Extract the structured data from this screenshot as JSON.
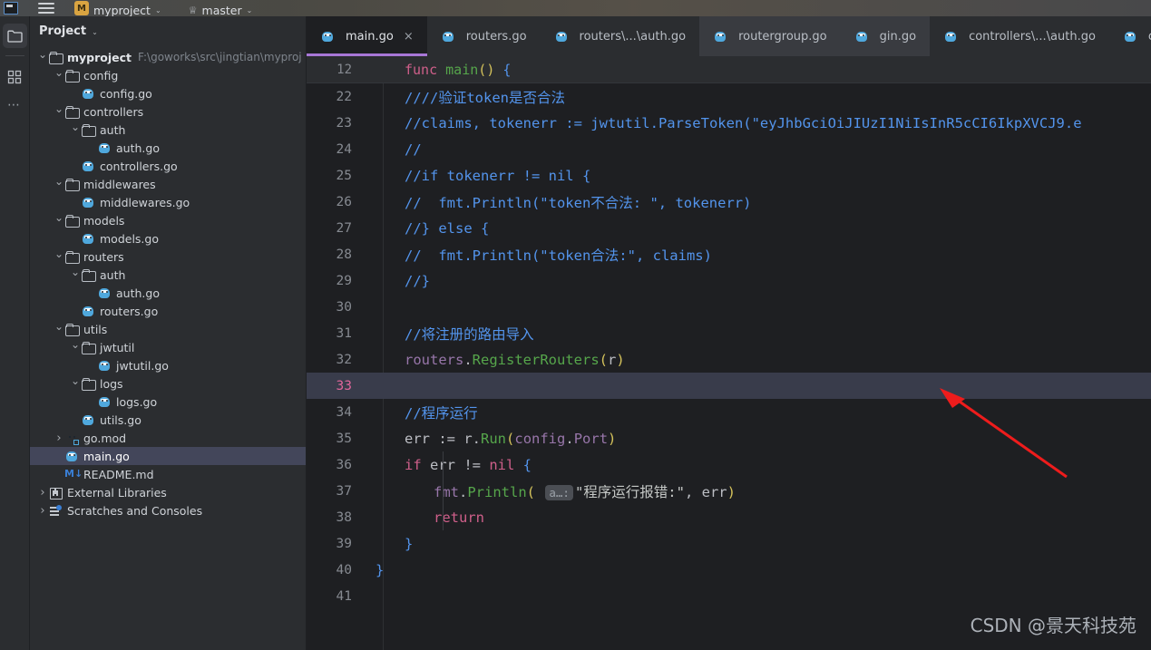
{
  "window": {
    "win_icon": "terminal-icon",
    "menu_icon": "hamburger-menu-icon",
    "project_badge": "M",
    "project_name": "myproject",
    "branch_icon": "branch-icon",
    "branch_name": "master",
    "caret": "⌄"
  },
  "rail": {
    "items": [
      {
        "name": "project-tool-icon",
        "label": "Project",
        "active": true
      },
      {
        "name": "structure-tool-icon",
        "label": "Structure",
        "active": false
      },
      {
        "name": "more-tool-icon",
        "label": "More",
        "active": false
      }
    ]
  },
  "panel": {
    "title": "Project",
    "caret": "⌄",
    "tree": [
      {
        "indent": 0,
        "arrow": "down",
        "icon": "folder",
        "label": "myproject",
        "bold": true,
        "path": "F:\\goworks\\src\\jingtian\\myproj",
        "selected": false
      },
      {
        "indent": 1,
        "arrow": "down",
        "icon": "folder",
        "label": "config",
        "bold": false,
        "path": "",
        "selected": false
      },
      {
        "indent": 2,
        "arrow": "none",
        "icon": "go",
        "label": "config.go",
        "bold": false,
        "path": "",
        "selected": false
      },
      {
        "indent": 1,
        "arrow": "down",
        "icon": "folder",
        "label": "controllers",
        "bold": false,
        "path": "",
        "selected": false
      },
      {
        "indent": 2,
        "arrow": "down",
        "icon": "folder",
        "label": "auth",
        "bold": false,
        "path": "",
        "selected": false
      },
      {
        "indent": 3,
        "arrow": "none",
        "icon": "go",
        "label": "auth.go",
        "bold": false,
        "path": "",
        "selected": false
      },
      {
        "indent": 2,
        "arrow": "none",
        "icon": "go",
        "label": "controllers.go",
        "bold": false,
        "path": "",
        "selected": false
      },
      {
        "indent": 1,
        "arrow": "down",
        "icon": "folder",
        "label": "middlewares",
        "bold": false,
        "path": "",
        "selected": false
      },
      {
        "indent": 2,
        "arrow": "none",
        "icon": "go",
        "label": "middlewares.go",
        "bold": false,
        "path": "",
        "selected": false
      },
      {
        "indent": 1,
        "arrow": "down",
        "icon": "folder",
        "label": "models",
        "bold": false,
        "path": "",
        "selected": false
      },
      {
        "indent": 2,
        "arrow": "none",
        "icon": "go",
        "label": "models.go",
        "bold": false,
        "path": "",
        "selected": false
      },
      {
        "indent": 1,
        "arrow": "down",
        "icon": "folder",
        "label": "routers",
        "bold": false,
        "path": "",
        "selected": false
      },
      {
        "indent": 2,
        "arrow": "down",
        "icon": "folder",
        "label": "auth",
        "bold": false,
        "path": "",
        "selected": false
      },
      {
        "indent": 3,
        "arrow": "none",
        "icon": "go",
        "label": "auth.go",
        "bold": false,
        "path": "",
        "selected": false
      },
      {
        "indent": 2,
        "arrow": "none",
        "icon": "go",
        "label": "routers.go",
        "bold": false,
        "path": "",
        "selected": false
      },
      {
        "indent": 1,
        "arrow": "down",
        "icon": "folder",
        "label": "utils",
        "bold": false,
        "path": "",
        "selected": false
      },
      {
        "indent": 2,
        "arrow": "down",
        "icon": "folder",
        "label": "jwtutil",
        "bold": false,
        "path": "",
        "selected": false
      },
      {
        "indent": 3,
        "arrow": "none",
        "icon": "go",
        "label": "jwtutil.go",
        "bold": false,
        "path": "",
        "selected": false
      },
      {
        "indent": 2,
        "arrow": "down",
        "icon": "folder",
        "label": "logs",
        "bold": false,
        "path": "",
        "selected": false
      },
      {
        "indent": 3,
        "arrow": "none",
        "icon": "go",
        "label": "logs.go",
        "bold": false,
        "path": "",
        "selected": false
      },
      {
        "indent": 2,
        "arrow": "none",
        "icon": "go",
        "label": "utils.go",
        "bold": false,
        "path": "",
        "selected": false
      },
      {
        "indent": 1,
        "arrow": "right",
        "icon": "gomod",
        "label": "go.mod",
        "bold": false,
        "path": "",
        "selected": false
      },
      {
        "indent": 1,
        "arrow": "none",
        "icon": "go",
        "label": "main.go",
        "bold": false,
        "path": "",
        "selected": true
      },
      {
        "indent": 1,
        "arrow": "none",
        "icon": "md",
        "label": "README.md",
        "bold": false,
        "path": "",
        "selected": false
      },
      {
        "indent": 0,
        "arrow": "right",
        "icon": "lib",
        "label": "External Libraries",
        "bold": false,
        "path": "",
        "selected": false
      },
      {
        "indent": 0,
        "arrow": "right",
        "icon": "scratch",
        "label": "Scratches and Consoles",
        "bold": false,
        "path": "",
        "selected": false
      }
    ]
  },
  "tabs": [
    {
      "label": "main.go",
      "icon": "go-file-icon",
      "active": true,
      "closable": true,
      "hover": false
    },
    {
      "label": "routers.go",
      "icon": "go-file-icon",
      "active": false,
      "closable": false,
      "hover": false
    },
    {
      "label": "routers\\...\\auth.go",
      "icon": "go-file-icon",
      "active": false,
      "closable": false,
      "hover": false
    },
    {
      "label": "routergroup.go",
      "icon": "go-file-icon",
      "active": false,
      "closable": false,
      "hover": true
    },
    {
      "label": "gin.go",
      "icon": "go-file-icon",
      "active": false,
      "closable": false,
      "hover": true
    },
    {
      "label": "controllers\\...\\auth.go",
      "icon": "go-file-icon",
      "active": false,
      "closable": false,
      "hover": false
    },
    {
      "label": "cont",
      "icon": "go-file-icon",
      "active": false,
      "closable": false,
      "hover": false
    }
  ],
  "sticky": {
    "line_number": "12",
    "tokens": [
      {
        "t": "func ",
        "c": "kw"
      },
      {
        "t": "main",
        "c": "fn"
      },
      {
        "t": "(",
        "c": "br1"
      },
      {
        "t": ")",
        "c": "br1"
      },
      {
        "t": " ",
        "c": "pl"
      },
      {
        "t": "{",
        "c": "br2"
      }
    ]
  },
  "code": {
    "current_line": 33,
    "lines": [
      {
        "n": "22",
        "tokens": [
          {
            "t": "////验证token是否合法",
            "c": "cm"
          }
        ]
      },
      {
        "n": "23",
        "tokens": [
          {
            "t": "//claims, tokenerr := jwtutil.ParseToken(\"eyJhbGciOiJIUzI1NiIsInR5cCI6IkpXVCJ9.e",
            "c": "cm"
          }
        ]
      },
      {
        "n": "24",
        "tokens": [
          {
            "t": "//",
            "c": "cm"
          }
        ]
      },
      {
        "n": "25",
        "tokens": [
          {
            "t": "//if tokenerr != nil {",
            "c": "cm"
          }
        ]
      },
      {
        "n": "26",
        "tokens": [
          {
            "t": "//  fmt.Println(\"token不合法: \", tokenerr)",
            "c": "cm"
          }
        ]
      },
      {
        "n": "27",
        "tokens": [
          {
            "t": "//} else {",
            "c": "cm"
          }
        ]
      },
      {
        "n": "28",
        "tokens": [
          {
            "t": "//  fmt.Println(\"token合法:\", claims)",
            "c": "cm"
          }
        ]
      },
      {
        "n": "29",
        "tokens": [
          {
            "t": "//}",
            "c": "cm"
          }
        ]
      },
      {
        "n": "30",
        "tokens": []
      },
      {
        "n": "31",
        "tokens": [
          {
            "t": "//将注册的路由导入",
            "c": "cm"
          }
        ]
      },
      {
        "n": "32",
        "tokens": [
          {
            "t": "routers",
            "c": "pkg"
          },
          {
            "t": ".",
            "c": "pl"
          },
          {
            "t": "RegisterRouters",
            "c": "fn"
          },
          {
            "t": "(",
            "c": "br1"
          },
          {
            "t": "r",
            "c": "id"
          },
          {
            "t": ")",
            "c": "br1"
          }
        ]
      },
      {
        "n": "33",
        "tokens": []
      },
      {
        "n": "34",
        "tokens": [
          {
            "t": "//程序运行",
            "c": "cm"
          }
        ]
      },
      {
        "n": "35",
        "tokens": [
          {
            "t": "err",
            "c": "id"
          },
          {
            "t": " := ",
            "c": "pl"
          },
          {
            "t": "r",
            "c": "id"
          },
          {
            "t": ".",
            "c": "pl"
          },
          {
            "t": "Run",
            "c": "fn"
          },
          {
            "t": "(",
            "c": "br1"
          },
          {
            "t": "config",
            "c": "pkg"
          },
          {
            "t": ".",
            "c": "pl"
          },
          {
            "t": "Port",
            "c": "pkg"
          },
          {
            "t": ")",
            "c": "br1"
          }
        ]
      },
      {
        "n": "36",
        "tokens": [
          {
            "t": "if ",
            "c": "kw"
          },
          {
            "t": "err != ",
            "c": "id"
          },
          {
            "t": "nil",
            "c": "kw"
          },
          {
            "t": " ",
            "c": "pl"
          },
          {
            "t": "{",
            "c": "br2"
          }
        ],
        "indent_guide": true
      },
      {
        "n": "37",
        "indent": 1,
        "indent_guide": true,
        "tokens": [
          {
            "t": "fmt",
            "c": "pkg"
          },
          {
            "t": ".",
            "c": "pl"
          },
          {
            "t": "Println",
            "c": "fn"
          },
          {
            "t": "(",
            "c": "br1"
          },
          {
            "t": " ",
            "c": "pl"
          },
          {
            "t": "a…:",
            "c": "hintbadge"
          },
          {
            "t": "\"程序运行报错:\"",
            "c": "str"
          },
          {
            "t": ", ",
            "c": "pl"
          },
          {
            "t": "err",
            "c": "id"
          },
          {
            "t": ")",
            "c": "br1"
          }
        ]
      },
      {
        "n": "38",
        "indent": 1,
        "indent_guide": true,
        "tokens": [
          {
            "t": "return",
            "c": "kw"
          }
        ]
      },
      {
        "n": "39",
        "tokens": [
          {
            "t": "}",
            "c": "br2"
          }
        ]
      },
      {
        "n": "40",
        "indent": -1,
        "tokens": [
          {
            "t": "}",
            "c": "br2"
          }
        ]
      },
      {
        "n": "41",
        "tokens": []
      }
    ]
  },
  "annotation": {
    "name": "red-arrow-pointer",
    "color": "#ee1c1c",
    "points_to_line": "33"
  },
  "watermark": {
    "text": "CSDN @景天科技苑"
  },
  "colors": {
    "editor_bg": "#1e1f22",
    "panel_bg": "#2b2d30",
    "active_tab_underline": "#a877d6",
    "current_line_bg": "#393c4b",
    "selection_bg": "#43465a",
    "comment": "#5394ec",
    "keyword": "#cf5f8a",
    "function": "#56a64b",
    "package": "#9876aa",
    "annotation_red": "#ee1c1c"
  }
}
